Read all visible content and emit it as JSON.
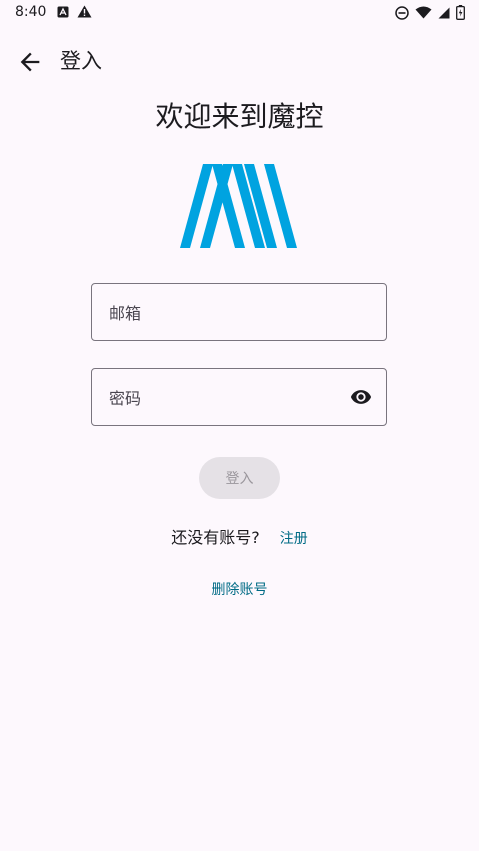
{
  "status_bar": {
    "time": "8:40",
    "left_icons": [
      "app-notification-icon",
      "warning-icon"
    ],
    "right_icons": [
      "do-not-disturb-icon",
      "wifi-icon",
      "signal-icon",
      "battery-icon"
    ]
  },
  "app_bar": {
    "back_icon": "arrow-back-icon",
    "title": "登入"
  },
  "welcome": "欢迎来到魔控",
  "logo": {
    "name": "logo-m",
    "color": "#00a3e0"
  },
  "form": {
    "email_placeholder": "邮箱",
    "email_value": "",
    "password_placeholder": "密码",
    "password_value": "",
    "password_toggle_icon": "eye-icon",
    "login_label": "登入"
  },
  "signup": {
    "prompt": "还没有账号?",
    "link": "注册"
  },
  "delete_account": "删除账号",
  "colors": {
    "background": "#fdf8fd",
    "link": "#006b85",
    "button_disabled_bg": "#e5e1e6",
    "outline": "#79747e"
  }
}
